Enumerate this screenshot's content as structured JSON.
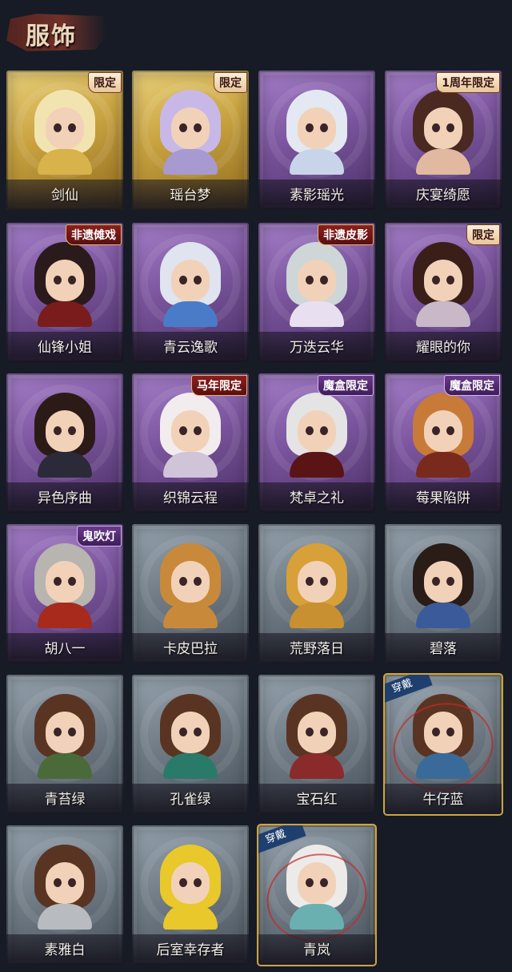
{
  "header": {
    "title": "服饰"
  },
  "outfits": [
    {
      "name": "剑仙",
      "tier": "gold",
      "badge": "限定",
      "badge_style": "plain",
      "hair": "#f2e4b0",
      "outfit": "#d8b24a",
      "worn": false
    },
    {
      "name": "瑶台梦",
      "tier": "gold",
      "badge": "限定",
      "badge_style": "plain",
      "hair": "#c8b8e8",
      "outfit": "#a79ad0",
      "worn": false
    },
    {
      "name": "素影瑶光",
      "tier": "purple",
      "badge": "",
      "badge_style": "plain",
      "hair": "#e4e8f2",
      "outfit": "#c8d4ea",
      "worn": false
    },
    {
      "name": "庆宴绮愿",
      "tier": "purple",
      "badge": "1周年限定",
      "badge_style": "plain",
      "hair": "#4a2a20",
      "outfit": "#e0b9a0",
      "worn": false
    },
    {
      "name": "仙锋小姐",
      "tier": "purple",
      "badge": "非遗傩戏",
      "badge_style": "red",
      "hair": "#2a1a1c",
      "outfit": "#7a1c1c",
      "worn": false
    },
    {
      "name": "青云逸歌",
      "tier": "purple",
      "badge": "",
      "badge_style": "plain",
      "hair": "#dfe4ee",
      "outfit": "#4a7bc8",
      "worn": false
    },
    {
      "name": "万迭云华",
      "tier": "purple",
      "badge": "非遗皮影",
      "badge_style": "red",
      "hair": "#cfd6d8",
      "outfit": "#e8e0f0",
      "worn": false
    },
    {
      "name": "耀眼的你",
      "tier": "purple",
      "badge": "限定",
      "badge_style": "plain",
      "hair": "#3a1e18",
      "outfit": "#c8b8c8",
      "worn": false
    },
    {
      "name": "异色序曲",
      "tier": "purple",
      "badge": "",
      "badge_style": "plain",
      "hair": "#2c1a16",
      "outfit": "#2a2a38",
      "worn": false
    },
    {
      "name": "织锦云程",
      "tier": "purple",
      "badge": "马年限定",
      "badge_style": "red",
      "hair": "#f2ecee",
      "outfit": "#d0c4d8",
      "worn": false
    },
    {
      "name": "梵卓之礼",
      "tier": "purple",
      "badge": "魔盒限定",
      "badge_style": "box",
      "hair": "#e4e4e4",
      "outfit": "#5a1416",
      "worn": false
    },
    {
      "name": "莓果陷阱",
      "tier": "purple",
      "badge": "魔盒限定",
      "badge_style": "box",
      "hair": "#c87a38",
      "outfit": "#7a2a1c",
      "worn": false
    },
    {
      "name": "胡八一",
      "tier": "purple",
      "badge": "鬼吹灯",
      "badge_style": "box",
      "hair": "#b8b4b0",
      "outfit": "#a82a1c",
      "worn": false
    },
    {
      "name": "卡皮巴拉",
      "tier": "grey",
      "badge": "",
      "badge_style": "plain",
      "hair": "#c88a3a",
      "outfit": "#c88a3a",
      "worn": false
    },
    {
      "name": "荒野落日",
      "tier": "grey",
      "badge": "",
      "badge_style": "plain",
      "hair": "#d8a038",
      "outfit": "#c89030",
      "worn": false
    },
    {
      "name": "碧落",
      "tier": "grey",
      "badge": "",
      "badge_style": "plain",
      "hair": "#2a1c16",
      "outfit": "#3a5a9a",
      "worn": false
    },
    {
      "name": "青苔绿",
      "tier": "grey",
      "badge": "",
      "badge_style": "plain",
      "hair": "#5a3422",
      "outfit": "#4a6a3a",
      "worn": false
    },
    {
      "name": "孔雀绿",
      "tier": "grey",
      "badge": "",
      "badge_style": "plain",
      "hair": "#5a3422",
      "outfit": "#2a7a6a",
      "worn": false
    },
    {
      "name": "宝石红",
      "tier": "grey",
      "badge": "",
      "badge_style": "plain",
      "hair": "#5a3422",
      "outfit": "#8a2a2a",
      "worn": false
    },
    {
      "name": "牛仔蓝",
      "tier": "grey",
      "badge": "",
      "badge_style": "plain",
      "hair": "#5a3422",
      "outfit": "#3a6a9a",
      "worn": true
    },
    {
      "name": "素雅白",
      "tier": "grey",
      "badge": "",
      "badge_style": "plain",
      "hair": "#5a3422",
      "outfit": "#b8bcc0",
      "worn": false
    },
    {
      "name": "后室幸存者",
      "tier": "grey",
      "badge": "",
      "badge_style": "plain",
      "hair": "#e8c82a",
      "outfit": "#e8c82a",
      "worn": false
    },
    {
      "name": "青岚",
      "tier": "grey",
      "badge": "",
      "badge_style": "plain",
      "hair": "#ecebea",
      "outfit": "#6ab0b0",
      "worn": true
    }
  ],
  "wear_label": "穿戴",
  "colors": {
    "background": "#161b26",
    "title": "#ecd7bb",
    "gold_border": "#c9a44a"
  }
}
